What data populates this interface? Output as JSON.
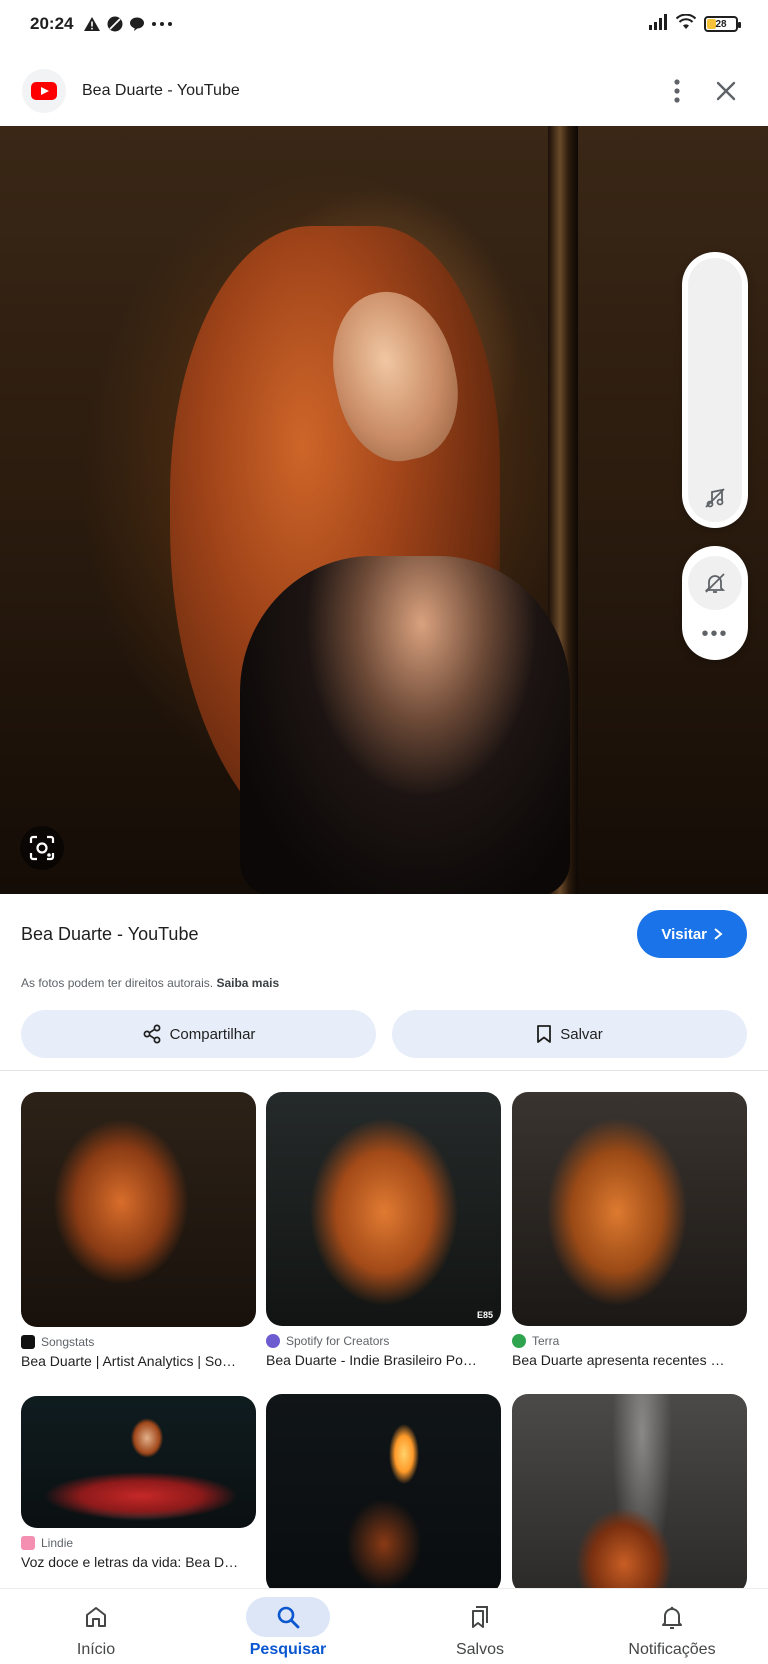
{
  "status_bar": {
    "time": "20:24",
    "battery": "28",
    "left_icons": [
      "warning-icon",
      "circle-slash-icon",
      "chat-bubble-icon",
      "more-dots-icon"
    ],
    "right_icons": [
      "signal-icon",
      "wifi-icon",
      "battery-icon"
    ]
  },
  "header": {
    "site_icon": "youtube-logo",
    "title": "Bea Duarte - YouTube",
    "actions": [
      "more-vert-icon",
      "close-icon"
    ]
  },
  "hero": {
    "lens_icon": "google-lens-icon"
  },
  "side_controls": {
    "icons": [
      "music-off-icon",
      "notifications-off-icon",
      "more-horiz-icon"
    ]
  },
  "info": {
    "site_title": "Bea Duarte - YouTube",
    "visit_label": "Visitar",
    "copyright_text": "As fotos podem ter direitos autorais.",
    "learn_more": "Saiba mais",
    "share_label": "Compartilhar",
    "save_label": "Salvar"
  },
  "related": [
    {
      "source": "Songstats",
      "caption": "Bea Duarte | Artist Analytics | So…",
      "source_color": "#111111"
    },
    {
      "source": "Spotify for Creators",
      "caption": "Bea Duarte - Indie Brasileiro Po…",
      "source_color": "#6d5bd0"
    },
    {
      "source": "Terra",
      "caption": "Bea Duarte apresenta recentes …",
      "source_color": "#2ea44f"
    },
    {
      "source": "Lindie",
      "caption": "Voz doce e letras da vida: Bea D…",
      "source_color": "#f48fb1"
    },
    {
      "source": "",
      "caption": ""
    },
    {
      "source": "",
      "caption": ""
    }
  ],
  "thumb_badge": "E85",
  "bottom_nav": {
    "items": [
      {
        "label": "Início",
        "icon": "home-icon",
        "active": false
      },
      {
        "label": "Pesquisar",
        "icon": "search-icon",
        "active": true
      },
      {
        "label": "Salvos",
        "icon": "bookmarks-icon",
        "active": false
      },
      {
        "label": "Notificações",
        "icon": "bell-icon",
        "active": false
      }
    ]
  },
  "colors": {
    "accent": "#1a73e8",
    "active_nav": "#0b57d0",
    "pill_button_bg": "#e8eef9",
    "youtube_red": "#ff0000"
  }
}
